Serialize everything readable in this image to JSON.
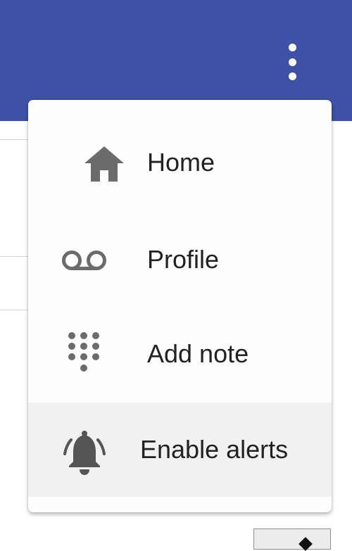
{
  "app_bar": {
    "color": "#3f51a5",
    "overflow_icon": "more-vert-icon"
  },
  "menu": {
    "items": [
      {
        "label": "Home",
        "icon": "home-icon"
      },
      {
        "label": "Profile",
        "icon": "voicemail-icon"
      },
      {
        "label": "Add note",
        "icon": "dialpad-icon"
      },
      {
        "label": "Enable alerts",
        "icon": "notifications-active-icon",
        "highlighted": true
      }
    ]
  }
}
